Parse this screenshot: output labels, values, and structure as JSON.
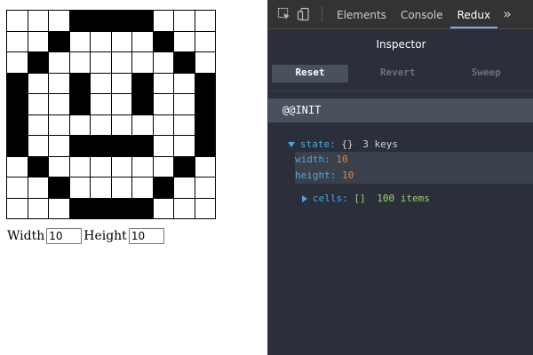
{
  "app": {
    "grid_size": 10,
    "on_cells": [
      3,
      4,
      5,
      6,
      12,
      17,
      21,
      28,
      30,
      33,
      36,
      39,
      40,
      43,
      46,
      49,
      50,
      59,
      60,
      63,
      64,
      65,
      66,
      69,
      71,
      78,
      82,
      87,
      93,
      94,
      95,
      96
    ],
    "width_label": "Width",
    "width_value": "10",
    "height_label": "Height",
    "height_value": "10"
  },
  "devtools": {
    "tabs": [
      "Elements",
      "Console",
      "Redux"
    ],
    "active_tab": "Redux",
    "more": "»",
    "inspector": {
      "title": "Inspector",
      "buttons": [
        "Reset",
        "Revert",
        "Sweep"
      ],
      "action": "@@INIT",
      "state_key": "state:",
      "state_type": "{}",
      "state_count": "3 keys",
      "width_key": "width:",
      "width_value": "10",
      "height_key": "height:",
      "height_value": "10",
      "cells_key": "cells:",
      "cells_type": "[]",
      "cells_count": "100 items"
    }
  },
  "colors": {
    "devtools_bg": "#242424",
    "inspector_bg": "#2a2f3a",
    "key_blue": "#4fa6e0",
    "number_orange": "#e8843a",
    "green": "#9ad46b"
  }
}
